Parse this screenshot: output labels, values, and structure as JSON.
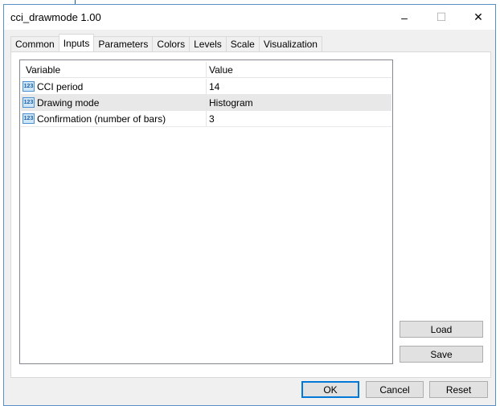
{
  "window": {
    "title": "cci_drawmode 1.00",
    "minimize": "–",
    "maximize": "☐",
    "close": "✕"
  },
  "tabs": [
    {
      "label": "Common"
    },
    {
      "label": "Inputs",
      "active": true
    },
    {
      "label": "Parameters"
    },
    {
      "label": "Colors"
    },
    {
      "label": "Levels"
    },
    {
      "label": "Scale"
    },
    {
      "label": "Visualization"
    }
  ],
  "table": {
    "headers": [
      "Variable",
      "Value"
    ],
    "icon": "123",
    "rows": [
      {
        "variable": "CCI period",
        "value": "14"
      },
      {
        "variable": "Drawing mode",
        "value": "Histogram"
      },
      {
        "variable": "Confirmation (number of bars)",
        "value": "3"
      }
    ]
  },
  "buttons": {
    "load": "Load",
    "save": "Save",
    "ok": "OK",
    "cancel": "Cancel",
    "reset": "Reset"
  }
}
